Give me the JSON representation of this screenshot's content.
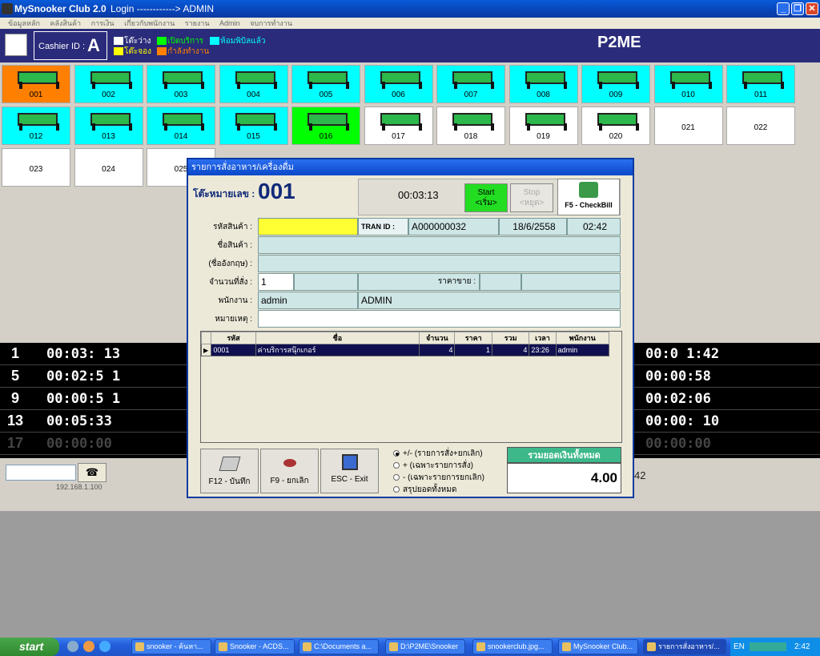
{
  "window": {
    "title": "MySnooker Club 2.0",
    "login_text": "Login ------------> ADMIN"
  },
  "menu": [
    "ข้อมูลหลัก",
    "คลังสินค้า",
    "การเงิน",
    "เกี่ยวกับพนักงาน",
    "รายงาน",
    "Admin",
    "จบการทำงาน"
  ],
  "header": {
    "cashier_label": "Cashier ID :",
    "cashier_id": "A",
    "brand": "P2ME",
    "legend": [
      {
        "label": "โต๊ะว่าง",
        "color": "#ffffff"
      },
      {
        "label": "เปิดบริการ",
        "color": "#00ff00"
      },
      {
        "label": "ห้อมพิบิลแล้ว",
        "color": "#00ffff"
      },
      {
        "label": "โต๊ะจอง",
        "color": "#ffff00"
      },
      {
        "label": "กำลังทำงาน",
        "color": "#ff8000"
      }
    ]
  },
  "tables": [
    {
      "num": "001",
      "status": "working"
    },
    {
      "num": "002",
      "status": "billed"
    },
    {
      "num": "003",
      "status": "billed"
    },
    {
      "num": "004",
      "status": "billed"
    },
    {
      "num": "005",
      "status": "billed"
    },
    {
      "num": "006",
      "status": "billed"
    },
    {
      "num": "007",
      "status": "billed"
    },
    {
      "num": "008",
      "status": "billed"
    },
    {
      "num": "009",
      "status": "billed"
    },
    {
      "num": "010",
      "status": "billed"
    },
    {
      "num": "011",
      "status": "billed"
    },
    {
      "num": "012",
      "status": "billed"
    },
    {
      "num": "013",
      "status": "billed"
    },
    {
      "num": "014",
      "status": "billed"
    },
    {
      "num": "015",
      "status": "billed"
    },
    {
      "num": "016",
      "status": "open"
    },
    {
      "num": "017",
      "status": "free"
    },
    {
      "num": "018",
      "status": "free"
    },
    {
      "num": "019",
      "status": "free"
    },
    {
      "num": "020",
      "status": "free"
    },
    {
      "num": "021",
      "status": "plain"
    },
    {
      "num": "022",
      "status": "plain"
    },
    {
      "num": "023",
      "status": "plain"
    },
    {
      "num": "024",
      "status": "plain"
    },
    {
      "num": "025",
      "status": "plain"
    }
  ],
  "timers": [
    {
      "num": "1",
      "left": "00:03: 13",
      "right": "00:0 1:42"
    },
    {
      "num": "5",
      "left": "00:02:5 1",
      "right": "00:00:58"
    },
    {
      "num": "9",
      "left": "00:00:5 1",
      "right": "00:02:06"
    },
    {
      "num": "13",
      "left": "00:05:33",
      "right": "00:00: 10"
    },
    {
      "num": "17",
      "left": "00:00:00",
      "right": "00:00:00"
    }
  ],
  "bottom": {
    "ip": "192.168.1.100",
    "side_value": "42"
  },
  "dialog": {
    "title": "รายการสั่งอาหาร/เครื่องดื่ม",
    "table_label": "โต๊ะหมายเลข :",
    "table_number": "001",
    "elapsed": "00:03:13",
    "start_label": "Start",
    "start_sub": "<เริ่ม>",
    "stop_label": "Stop",
    "stop_sub": "<หยุด>",
    "checkbill_label": "F5 - CheckBill",
    "fields": {
      "product_code_label": "รหัสสินค้า :",
      "product_name_label": "ชื่อสินค้า :",
      "english_name_label": "(ชื่ออังกฤษ) :",
      "qty_label": "จำนวนที่สั่ง :",
      "qty_value": "1",
      "price_label": "ราคาขาย :",
      "staff_label": "พนักงาน :",
      "staff_value": "admin",
      "staff_name": "ADMIN",
      "note_label": "หมายเหตุ :",
      "tran_label": "TRAN ID :",
      "tran_id": "A000000032",
      "date": "18/6/2558",
      "time": "02:42"
    },
    "grid": {
      "headers": [
        "รหัส",
        "ชื่อ",
        "จำนวน",
        "ราคา",
        "รวม",
        "เวลา",
        "พนักงาน"
      ],
      "rows": [
        [
          "0001",
          "ค่าบริการสนุ๊กเกอร์",
          "4",
          "1",
          "4",
          "23:26",
          "admin"
        ]
      ]
    },
    "buttons": {
      "save": "F12 - บันทึก",
      "cancel": "F9 - ยกเลิก",
      "exit": "ESC - Exit"
    },
    "radios": [
      {
        "label": "+/- (รายการสั่ง+ยกเลิก)",
        "checked": true
      },
      {
        "label": "+ (เฉพาะรายการสั่ง)",
        "checked": false
      },
      {
        "label": "- (เฉพาะรายการยกเลิก)",
        "checked": false
      },
      {
        "label": "สรุปยอดทั้งหมด",
        "checked": false
      }
    ],
    "total_label": "รวมยอดเงินทั้งหมด",
    "total_value": "4.00"
  },
  "taskbar": {
    "start": "start",
    "items": [
      {
        "label": "snooker - ค้นหา..."
      },
      {
        "label": "Snooker - ACDS..."
      },
      {
        "label": "C:\\Documents a..."
      },
      {
        "label": "D:\\P2ME\\Snooker"
      },
      {
        "label": "snookerclub.jpg..."
      },
      {
        "label": "MySnooker Club..."
      },
      {
        "label": "รายการสั่งอาหาร/..."
      }
    ],
    "lang": "EN",
    "clock": "2:42"
  },
  "colors": {
    "working": "#ff8000",
    "billed": "#00ffff",
    "open": "#00ff00",
    "free": "#ffffff",
    "plain": "#ffffff",
    "header_bg": "#2a2b7a"
  }
}
